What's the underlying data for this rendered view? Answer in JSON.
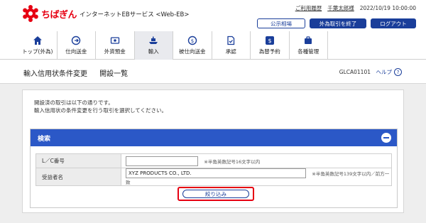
{
  "brand": {
    "logo_text": "ちばぎん",
    "service_name": "インターネットEBサービス <Web-EB>",
    "accent_color": "#e60012",
    "primary_color": "#1a3e9a"
  },
  "header": {
    "usage_history": "ご利用履歴",
    "user_name": "千葉太郎様",
    "timestamp": "2022/10/19 10:00:00",
    "public_rates_button": "公示相場",
    "end_fx_button": "外為取引を終了",
    "logout_button": "ログアウト"
  },
  "nav": {
    "items": [
      {
        "label": "トップ(外為)",
        "icon": "home-icon"
      },
      {
        "label": "仕向送金",
        "icon": "outbound-remittance-icon"
      },
      {
        "label": "外貨預金",
        "icon": "deposit-icon"
      },
      {
        "label": "輸入",
        "icon": "import-ship-icon",
        "active": true
      },
      {
        "label": "被仕向送金",
        "icon": "inbound-remittance-icon"
      },
      {
        "label": "承認",
        "icon": "approval-icon"
      },
      {
        "label": "為替予約",
        "icon": "fx-contract-icon"
      },
      {
        "label": "各種管理",
        "icon": "management-icon"
      }
    ]
  },
  "page": {
    "title": "輸入信用状条件変更 開設一覧",
    "screen_id": "GLCA01101",
    "help_label": "ヘルプ",
    "help_icon": "?"
  },
  "intro": {
    "line1": "開設済の取引は以下の通りです。",
    "line2": "輸入信用状の条件変更を行う取引を選択してください。"
  },
  "search": {
    "title": "検索",
    "lc_label": "L／C番号",
    "lc_value": "",
    "lc_hint": "※半角英数記号16文字以内",
    "beneficiary_label": "受益者名",
    "beneficiary_value": "XYZ PRODUCTS CO., LTD.",
    "beneficiary_hint": "※半角英数記号139文字以内／前方一致",
    "filter_button": "絞り込み"
  }
}
